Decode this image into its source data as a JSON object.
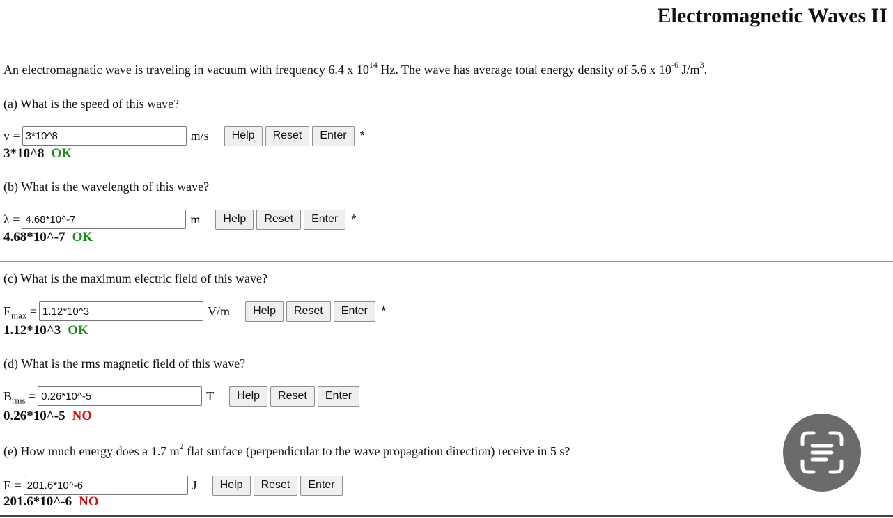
{
  "title": "Electromagnetic Waves II",
  "intro": {
    "a": "An electromagnatic wave is traveling in vacuum with frequency 6.4 x 10",
    "exp1": "14",
    "b": " Hz. The wave has average total energy density of 5.6 x 10",
    "exp2": "-6",
    "c": " J/m",
    "exp3": "3",
    "d": "."
  },
  "buttons": {
    "help": "Help",
    "reset": "Reset",
    "enter": "Enter"
  },
  "parts": {
    "a": {
      "question": "(a) What is the speed of this wave?",
      "label": "v =",
      "input": "3*10^8",
      "unit": "m/s",
      "star": "*",
      "answer": "3*10^8",
      "status": "OK"
    },
    "b": {
      "question": "(b) What is the wavelength of this wave?",
      "label": "λ =",
      "input": "4.68*10^-7",
      "unit": "m",
      "star": "*",
      "answer": "4.68*10^-7",
      "status": "OK"
    },
    "c": {
      "question": "(c) What is the maximum electric field of this wave?",
      "label_main": "E",
      "label_sub": "max",
      "label_eq": " =",
      "input": "1.12*10^3",
      "unit": "V/m",
      "star": "*",
      "answer": "1.12*10^3",
      "status": "OK"
    },
    "d": {
      "question": "(d) What is the rms magnetic field of this wave?",
      "label_main": "B",
      "label_sub": "rms",
      "label_eq": " =",
      "input": "0.26*10^-5",
      "unit": "T",
      "answer": "0.26*10^-5",
      "status": "NO"
    },
    "e": {
      "question_a": "(e) How much energy does a 1.7 m",
      "question_exp": "2",
      "question_b": " flat surface (perpendicular to the wave propagation direction) receive in 5 s?",
      "label": "E =",
      "input": "201.6*10^-6",
      "unit": "J",
      "answer": "201.6*10^-6",
      "status": "NO"
    }
  },
  "colors": {
    "ok": "#1c8a1c",
    "no": "#d01010"
  },
  "overlay_icon": "scan-text-icon"
}
